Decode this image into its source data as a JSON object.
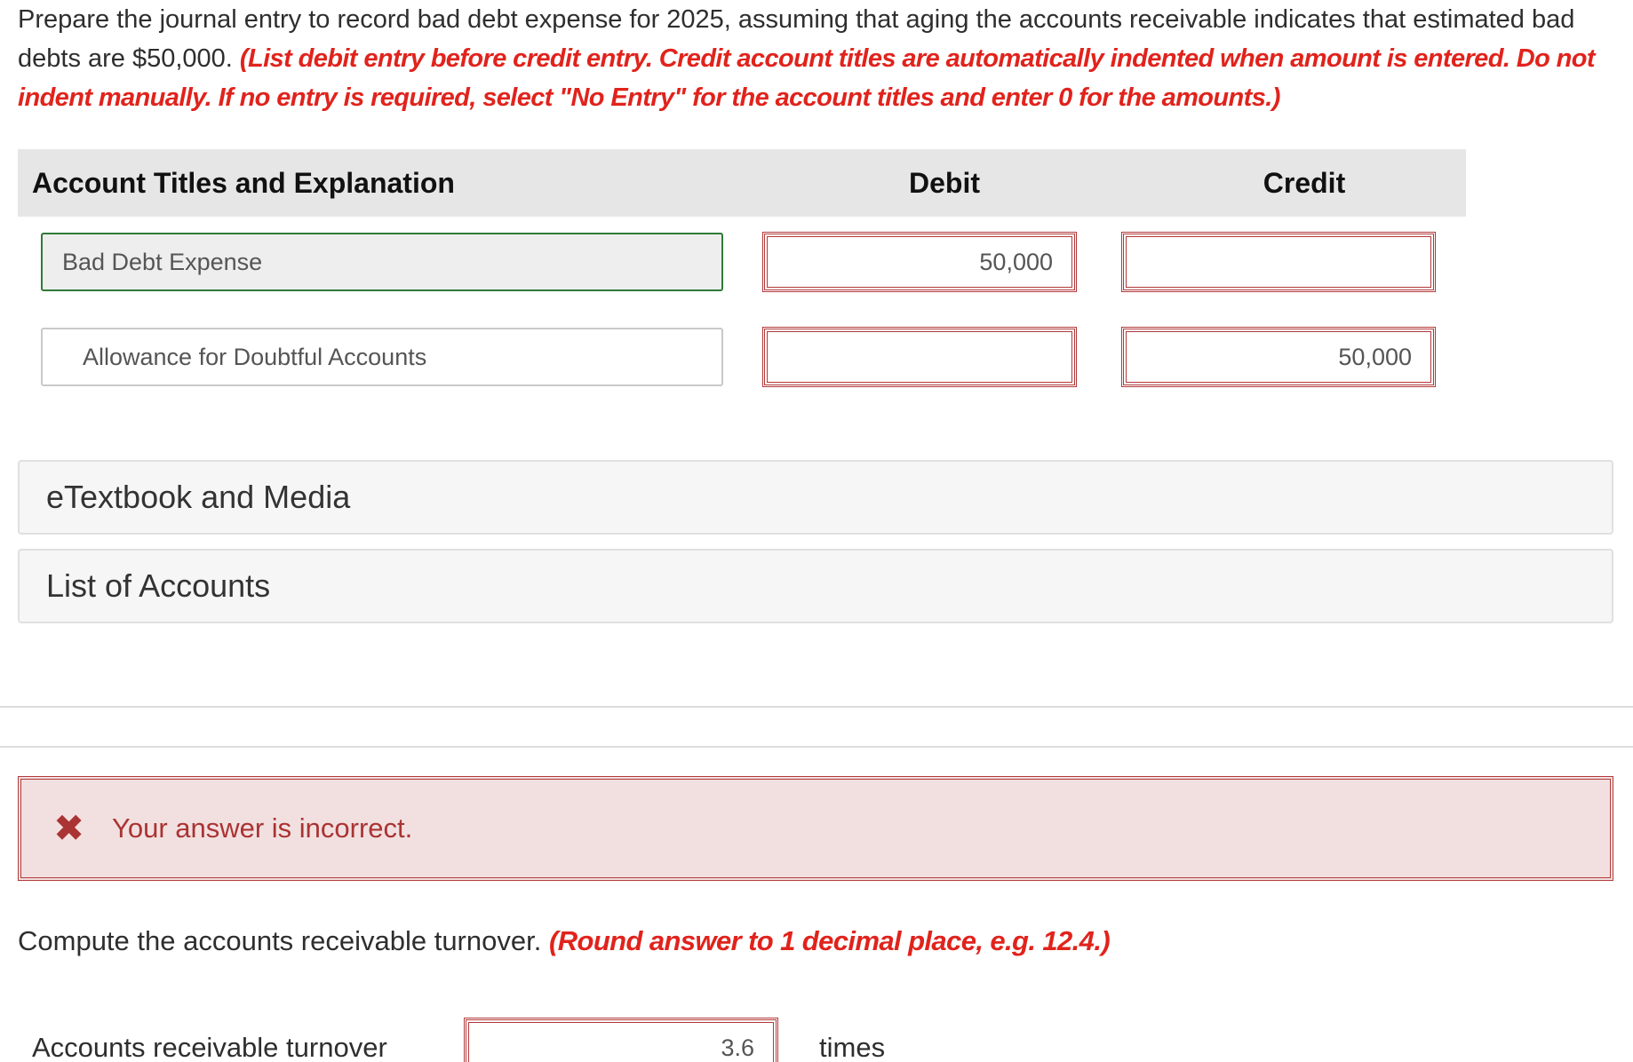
{
  "question": {
    "text": "Prepare the journal entry to record bad debt expense for 2025, assuming that aging the accounts receivable indicates that estimated bad debts are $50,000.",
    "instruction": "(List debit entry before credit entry. Credit account titles are automatically indented when amount is entered. Do not indent manually. If no entry is required, select \"No Entry\" for the account titles and enter 0 for the amounts.)"
  },
  "table": {
    "headers": {
      "account": "Account Titles and Explanation",
      "debit": "Debit",
      "credit": "Credit"
    },
    "rows": [
      {
        "account": "Bad Debt Expense",
        "debit": "50,000",
        "credit": ""
      },
      {
        "account": "Allowance for Doubtful Accounts",
        "debit": "",
        "credit": "50,000"
      }
    ]
  },
  "panels": {
    "etextbook": "eTextbook and Media",
    "list_of_accounts": "List of Accounts"
  },
  "feedback": {
    "icon": "close-icon",
    "message": "Your answer is incorrect."
  },
  "question2": {
    "text": "Compute the accounts receivable turnover.",
    "instruction": "(Round answer to 1 decimal place, e.g. 12.4.)",
    "label": "Accounts receivable turnover",
    "value": "3.6",
    "unit": "times"
  },
  "colors": {
    "instruction_red": "#e0231c",
    "error_border": "#b23a3a",
    "correct_border": "#2f7a36",
    "feedback_bg": "#f2e0e0"
  }
}
